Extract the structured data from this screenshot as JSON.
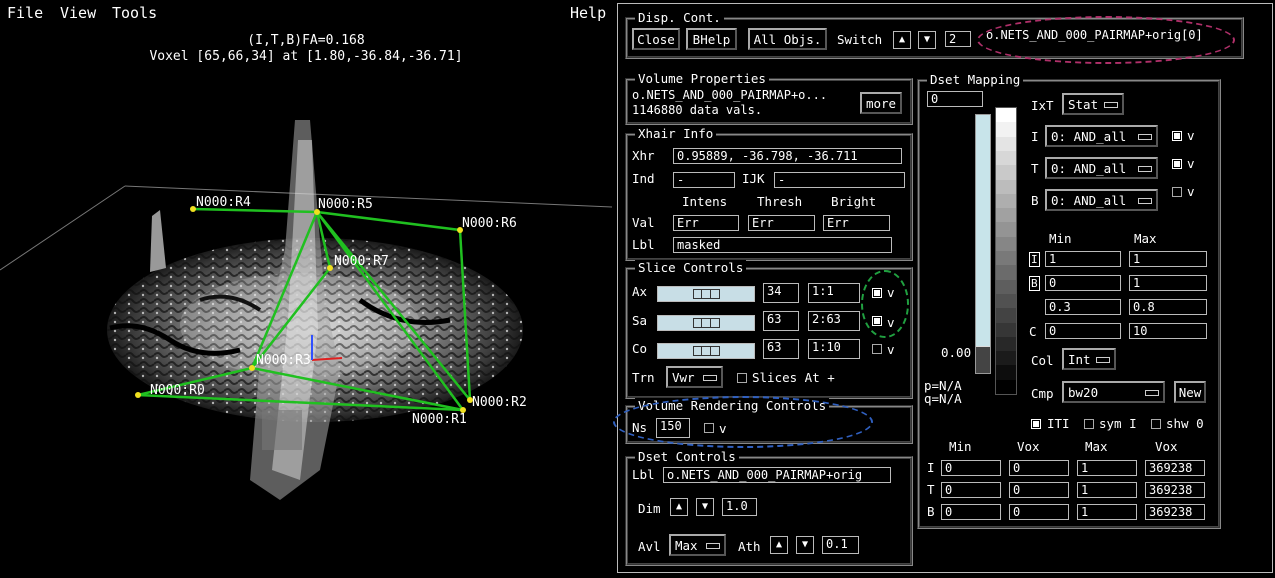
{
  "menubar": {
    "file": "File",
    "view": "View",
    "tools": "Tools",
    "help": "Help"
  },
  "viewer": {
    "fa_line": "(I,T,B)FA=0.168",
    "voxel_line": "Voxel [65,66,34] at [1.80,-36.84,-36.71]",
    "nodes": [
      "N000:R0",
      "N000:R1",
      "N000:R2",
      "N000:R3",
      "N000:R4",
      "N000:R5",
      "N000:R6",
      "N000:R7"
    ],
    "node_color": "#f0e020",
    "edge_color": "#20c020"
  },
  "disp_cont": {
    "title": "Disp. Cont.",
    "close": "Close",
    "bhelp": "BHelp",
    "all_objs": "All Objs.",
    "switch": "Switch",
    "switch_value": "2",
    "object_name": "o.NETS_AND_000_PAIRMAP+orig[0]"
  },
  "volume_props": {
    "title": "Volume Properties",
    "line1": "o.NETS_AND_000_PAIRMAP+o...",
    "line2": "1146880 data vals.",
    "more": "more"
  },
  "xhair": {
    "title": "Xhair Info",
    "xhr_label": "Xhr",
    "xhr_value": "0.95889, -36.798, -36.711",
    "ind_label": "Ind",
    "ind_value": "-",
    "ijk_label": "IJK",
    "ijk_value": "-",
    "intens": "Intens",
    "thresh": "Thresh",
    "bright": "Bright",
    "val_label": "Val",
    "val_intens": "Err",
    "val_thresh": "Err",
    "val_bright": "Err",
    "lbl_label": "Lbl",
    "lbl_value": "masked"
  },
  "slice": {
    "title": "Slice Controls",
    "ax": "Ax",
    "ax_num": "34",
    "ax_range": "1:1",
    "sa": "Sa",
    "sa_num": "63",
    "sa_range": "2:63",
    "co": "Co",
    "co_num": "63",
    "co_range": "1:10",
    "v": "v",
    "trn": "Trn",
    "trn_value": "Vwr",
    "slices_at": "Slices At +"
  },
  "vrender": {
    "title": "Volume Rendering Controls",
    "ns": "Ns",
    "ns_value": "150",
    "v": "v"
  },
  "dset_controls": {
    "title": "Dset Controls",
    "lbl": "Lbl",
    "lbl_value": "o.NETS_AND_000_PAIRMAP+orig",
    "dim": "Dim",
    "dim_value": "1.0",
    "avl": "Avl",
    "avl_value": "Max",
    "ath": "Ath",
    "ath_value": "0.1"
  },
  "dset_mapping": {
    "title": "Dset Mapping",
    "top_value": "0",
    "bottom_value": "0.00",
    "p": "p=N/A",
    "q": "q=N/A",
    "ixt": "IxT",
    "ixt_value": "Stat",
    "i": "I",
    "i_value": "0: AND_all",
    "t": "T",
    "t_value": "0: AND_all",
    "b": "B",
    "b_value": "0: AND_all",
    "v": "v",
    "min": "Min",
    "max": "Max",
    "row_i": "I",
    "row_b": "B",
    "row_c": "C",
    "r1_min": "1",
    "r1_max": "1",
    "r2_min": "0",
    "r2_max": "1",
    "r3_min": "0.3",
    "r3_max": "0.8",
    "r4_min": "0",
    "r4_max": "10",
    "col": "Col",
    "col_value": "Int",
    "cmp": "Cmp",
    "cmp_value": "bw20",
    "new": "New",
    "iti": "ITI",
    "sym_i": "sym I",
    "shw_0": "shw 0",
    "h_min": "Min",
    "h_vox": "Vox",
    "h_max": "Max",
    "h_vox2": "Vox",
    "rows": [
      {
        "label": "I",
        "min": "0",
        "vox": "0",
        "max": "1",
        "vox2": "369238"
      },
      {
        "label": "T",
        "min": "0",
        "vox": "0",
        "max": "1",
        "vox2": "369238"
      },
      {
        "label": "B",
        "min": "0",
        "vox": "0",
        "max": "1",
        "vox2": "369238"
      }
    ]
  }
}
